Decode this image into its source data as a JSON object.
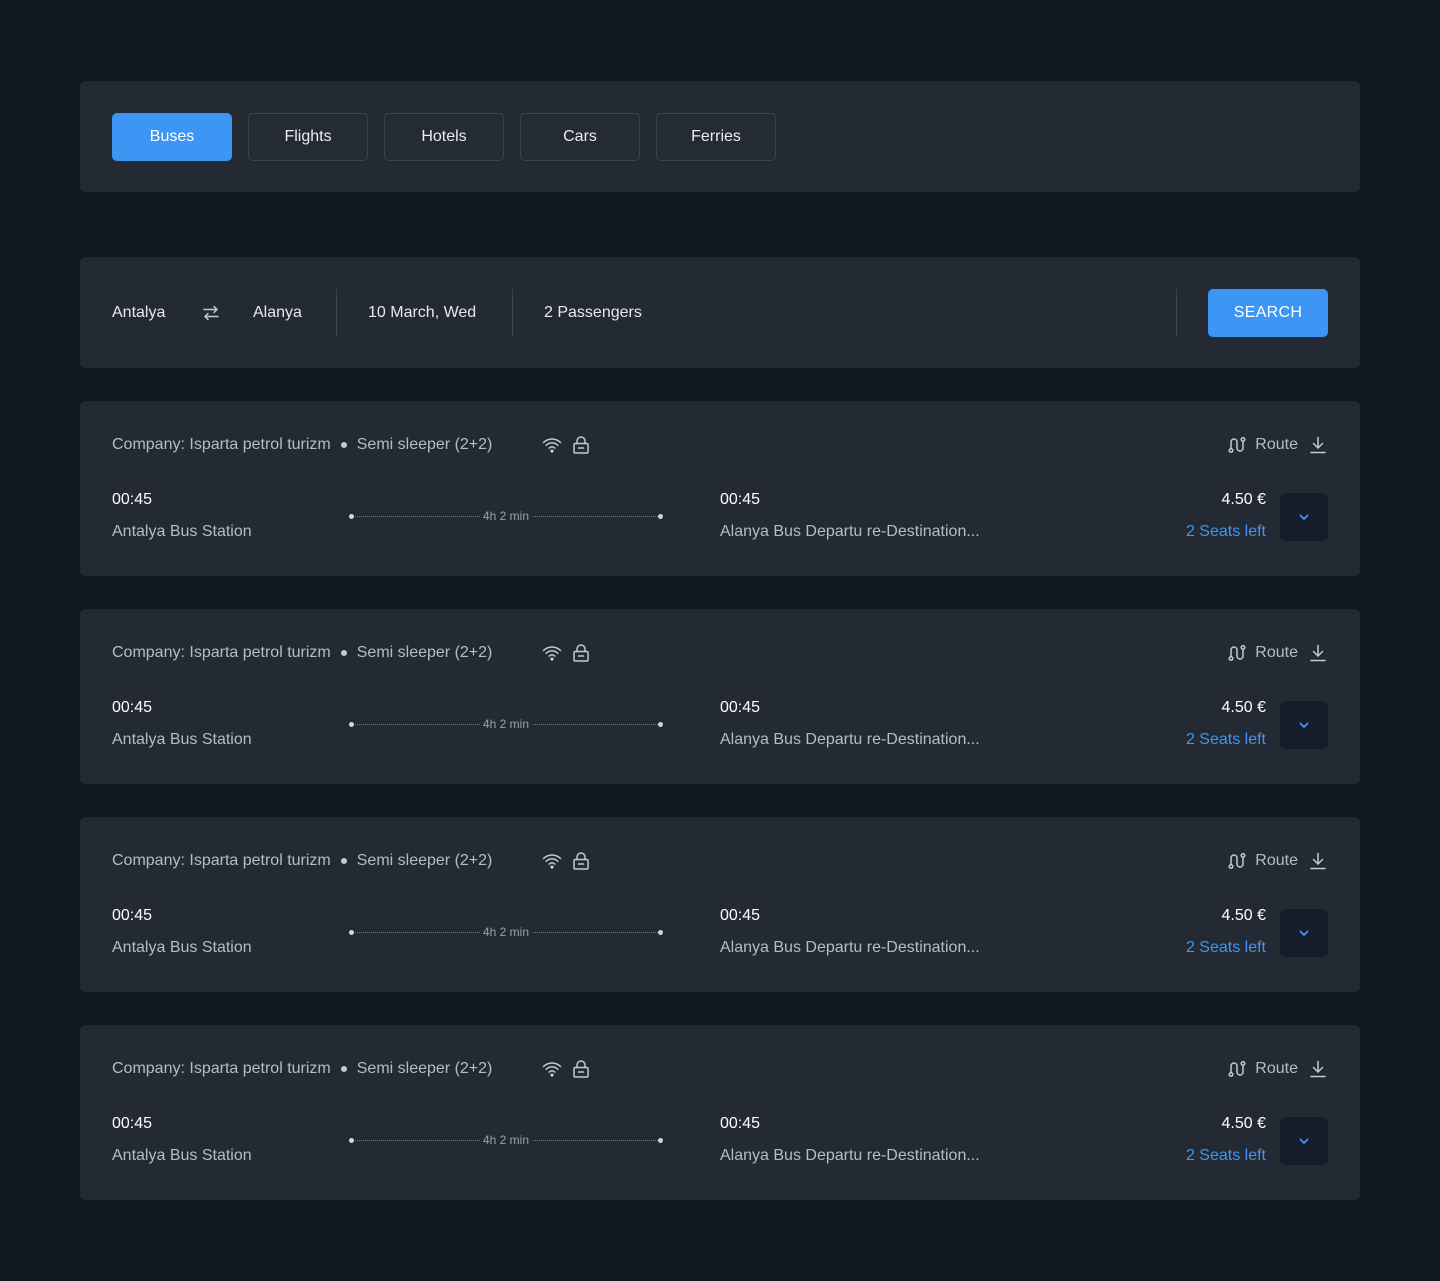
{
  "tabs": [
    {
      "label": "Buses",
      "active": true
    },
    {
      "label": "Flights",
      "active": false
    },
    {
      "label": "Hotels",
      "active": false
    },
    {
      "label": "Cars",
      "active": false
    },
    {
      "label": "Ferries",
      "active": false
    }
  ],
  "search": {
    "from": "Antalya",
    "to": "Alanya",
    "date": "10 March, Wed",
    "passengers": "2 Passengers",
    "button_label": "SEARCH",
    "swap_icon": "swap-arrows-icon"
  },
  "colors": {
    "background": "#111721",
    "panel": "#232a33",
    "accent": "#3d95f4",
    "expand_button": "#151c2a"
  },
  "results": [
    {
      "company": "Company: Isparta petrol turizm",
      "seat_type": "Semi sleeper (2+2)",
      "amenities": [
        "wifi-icon",
        "lock-icon"
      ],
      "route_label": "Route",
      "depart_time": "00:45",
      "depart_station": "Antalya Bus Station",
      "duration": "4h 2 min",
      "arrive_time": "00:45",
      "arrive_station": "Alanya Bus Departu re-Destination...",
      "price": "4.50 €",
      "seats": "2 Seats left"
    },
    {
      "company": "Company: Isparta petrol turizm",
      "seat_type": "Semi sleeper (2+2)",
      "amenities": [
        "wifi-icon",
        "lock-icon"
      ],
      "route_label": "Route",
      "depart_time": "00:45",
      "depart_station": "Antalya Bus Station",
      "duration": "4h 2 min",
      "arrive_time": "00:45",
      "arrive_station": "Alanya Bus Departu re-Destination...",
      "price": "4.50 €",
      "seats": "2 Seats left"
    },
    {
      "company": "Company: Isparta petrol turizm",
      "seat_type": "Semi sleeper (2+2)",
      "amenities": [
        "wifi-icon",
        "lock-icon"
      ],
      "route_label": "Route",
      "depart_time": "00:45",
      "depart_station": "Antalya Bus Station",
      "duration": "4h 2 min",
      "arrive_time": "00:45",
      "arrive_station": "Alanya Bus Departu re-Destination...",
      "price": "4.50 €",
      "seats": "2 Seats left"
    },
    {
      "company": "Company: Isparta petrol turizm",
      "seat_type": "Semi sleeper (2+2)",
      "amenities": [
        "wifi-icon",
        "lock-icon"
      ],
      "route_label": "Route",
      "depart_time": "00:45",
      "depart_station": "Antalya Bus Station",
      "duration": "4h 2 min",
      "arrive_time": "00:45",
      "arrive_station": "Alanya Bus Departu re-Destination...",
      "price": "4.50 €",
      "seats": "2 Seats left"
    }
  ]
}
